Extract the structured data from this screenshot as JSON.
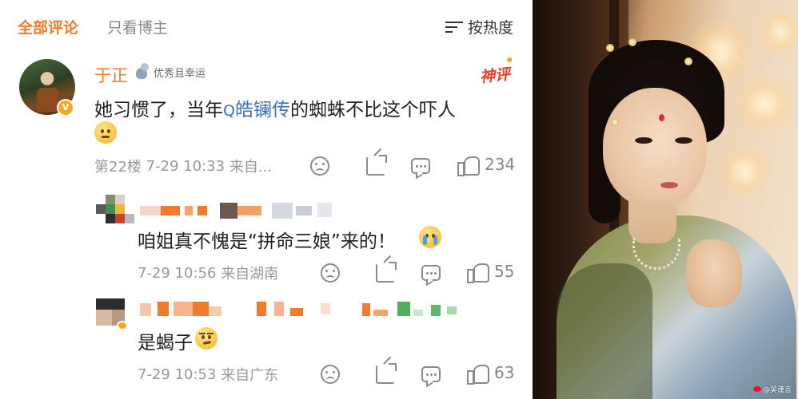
{
  "filter_bar": {
    "tab_all": "全部评论",
    "tab_blogger_only": "只看博主",
    "sort_label": "按热度"
  },
  "main_comment": {
    "author": "于正",
    "badge": "优秀且幸运",
    "hot_tag": "神评",
    "text_before": "她习惯了，当年",
    "topic_icon": "Q",
    "topic": "皓镧传",
    "text_after": "的蜘蛛不比这个吓人",
    "emoji": "thinking-emoji",
    "floor": "第22楼",
    "time": "7-29 10:33",
    "source": "来自...",
    "likes": "234"
  },
  "replies": [
    {
      "text": "咱姐真不愧是“拼命三娘”来的！",
      "emoji": "crying-emoji",
      "time": "7-29 10:56",
      "source": "来自湖南",
      "likes": "55"
    },
    {
      "text": "是蝎子",
      "emoji": "smirk-emoji",
      "time": "7-29 10:53",
      "source": "来自广东",
      "likes": "63"
    }
  ],
  "photo": {
    "watermark": "@吴谨言"
  },
  "colors": {
    "accent": "#f07b2a",
    "link": "#3a73b8",
    "meta": "#999999",
    "hot": "#e8412b"
  }
}
